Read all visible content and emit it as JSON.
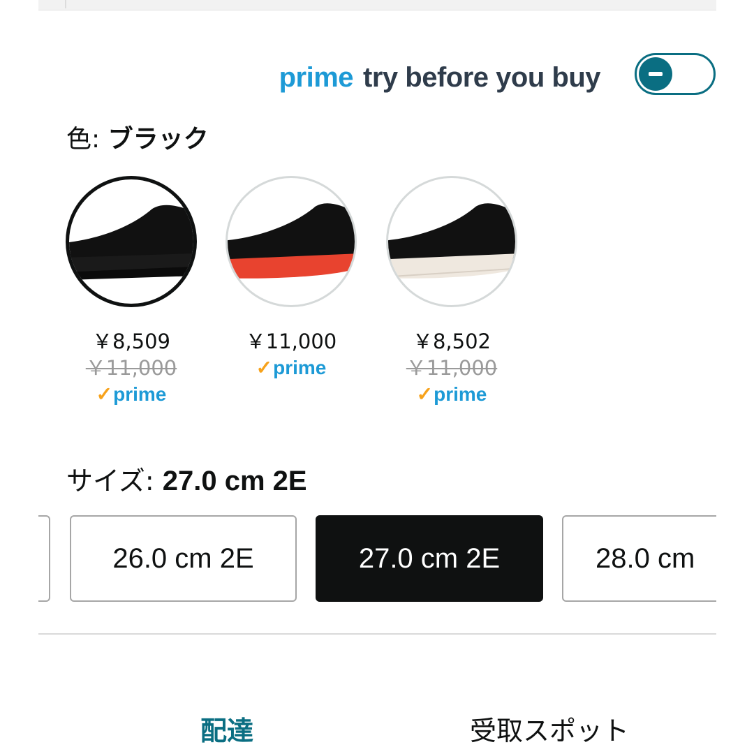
{
  "prime_try": {
    "prime_word": "prime",
    "label": "try before you buy",
    "toggle_state": "off"
  },
  "color": {
    "label_prefix": "色: ",
    "selected": "ブラック",
    "swatches": [
      {
        "price": "￥8,509",
        "list_price": "￥11,000",
        "prime": "prime",
        "sole_color": "#1a1a1a"
      },
      {
        "price": "￥11,000",
        "list_price": "",
        "prime": "prime",
        "sole_color": "#e8432f"
      },
      {
        "price": "￥8,502",
        "list_price": "￥11,000",
        "prime": "prime",
        "sole_color": "#efe8df"
      }
    ]
  },
  "size": {
    "label_prefix": "サイズ: ",
    "selected": "27.0 cm 2E",
    "options": [
      "",
      "26.0 cm 2E",
      "27.0 cm 2E",
      "28.0 cm"
    ]
  },
  "tabs": {
    "delivery": "配達",
    "pickup": "受取スポット"
  },
  "colors": {
    "accent": "#0a6e82",
    "prime_blue": "#1d9ad6",
    "prime_check": "#f7a21b"
  }
}
